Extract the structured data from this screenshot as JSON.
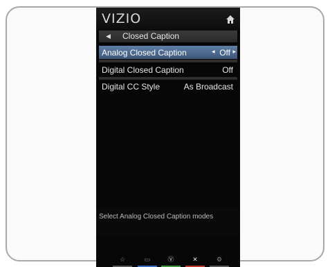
{
  "header": {
    "brand": "VIZIO",
    "home_icon": "home-icon"
  },
  "title_bar": {
    "back_icon": "back-arrow-icon",
    "title": "Closed Caption"
  },
  "menu": {
    "items": [
      {
        "label": "Analog Closed Caption",
        "value": "Off",
        "selected": true
      },
      {
        "label": "Digital Closed Caption",
        "value": "Off",
        "selected": false
      },
      {
        "label": "Digital CC Style",
        "value": "As Broadcast",
        "selected": false
      }
    ]
  },
  "status": {
    "text": "Select Analog Closed Caption modes"
  },
  "bottom_buttons": [
    {
      "icon": "star-icon",
      "glyph": "☆",
      "color": "#8a8a8a"
    },
    {
      "icon": "input-icon",
      "glyph": "▭",
      "color": "#3a6fc6"
    },
    {
      "icon": "vizio-v-icon",
      "glyph": "Ⓥ",
      "color": "#c9c9c9"
    },
    {
      "icon": "close-icon",
      "glyph": "✕",
      "color": "#c0392b"
    },
    {
      "icon": "gear-icon",
      "glyph": "⚙",
      "color": "#8a8a8a"
    }
  ],
  "colors": {
    "selection": "#4f6d94",
    "panel": "#070707",
    "frame_border": "#a8a8a8"
  }
}
